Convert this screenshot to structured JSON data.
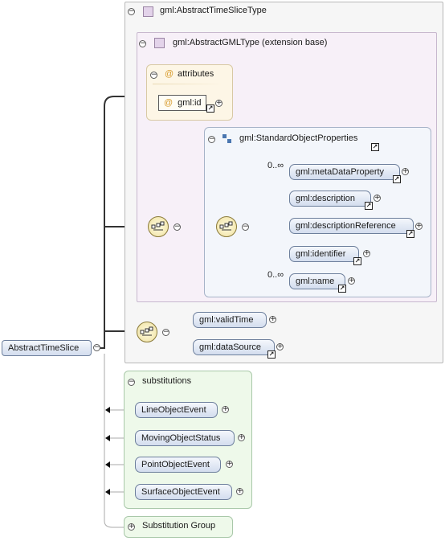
{
  "root": {
    "label": "AbstractTimeSlice"
  },
  "outer_type": {
    "label": "gml:AbstractTimeSliceType"
  },
  "ext_base": {
    "label": "gml:AbstractGMLType (extension base)"
  },
  "attributes": {
    "label": "attributes",
    "items": [
      {
        "label": "gml:id"
      }
    ]
  },
  "standard_props": {
    "label": "gml:StandardObjectProperties",
    "elements": [
      {
        "label": "gml:metaDataProperty",
        "multiplicity": "0..∞"
      },
      {
        "label": "gml:description"
      },
      {
        "label": "gml:descriptionReference"
      },
      {
        "label": "gml:identifier"
      },
      {
        "label": "gml:name",
        "multiplicity": "0..∞"
      }
    ]
  },
  "sequence2": {
    "elements": [
      {
        "label": "gml:validTime"
      },
      {
        "label": "gml:dataSource"
      }
    ]
  },
  "substitutions": {
    "label": "substitutions",
    "items": [
      {
        "label": "LineObjectEvent"
      },
      {
        "label": "MovingObjectStatus"
      },
      {
        "label": "PointObjectEvent"
      },
      {
        "label": "SurfaceObjectEvent"
      }
    ]
  },
  "substitution_group": {
    "label": "Substitution Group"
  },
  "glyphs": {
    "minus": "−",
    "plus": "+",
    "at": "@",
    "arrow": "↗"
  },
  "colors": {
    "element_fill": "#d3ddee",
    "attr_group": "#fdf6e6",
    "ext_base": "#f7f0f8",
    "substitutions": "#eef9ea"
  }
}
